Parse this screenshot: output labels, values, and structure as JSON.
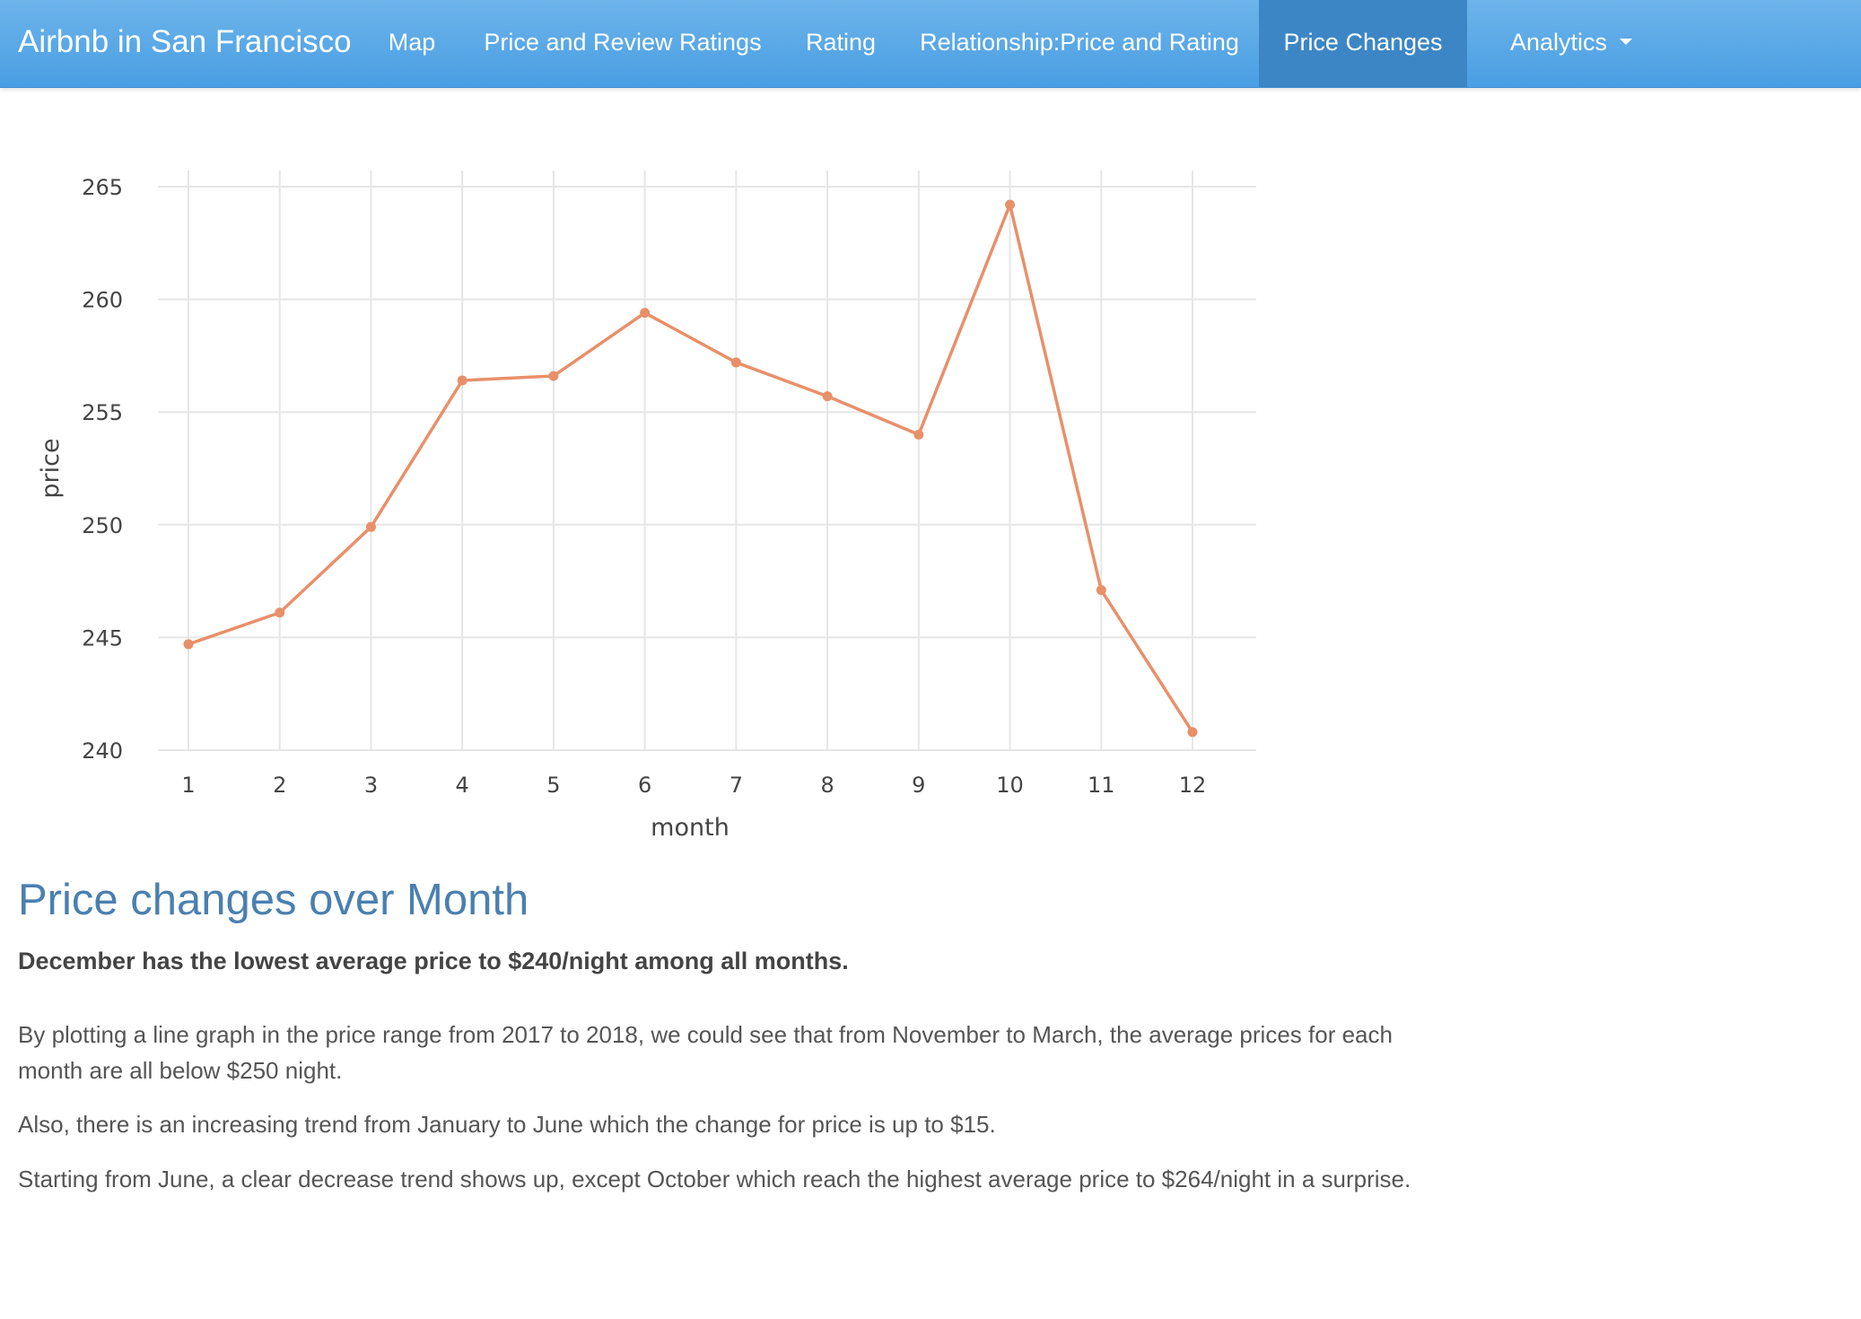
{
  "navbar": {
    "brand": "Airbnb in San Francisco",
    "items": [
      {
        "label": "Map"
      },
      {
        "label": "Price and Review Ratings"
      },
      {
        "label": "Rating"
      },
      {
        "label": "Relationship:Price and Rating"
      },
      {
        "label": "Price Changes",
        "active": true
      },
      {
        "label": "Analytics",
        "dropdown": true
      }
    ]
  },
  "chart_data": {
    "type": "line",
    "xlabel": "month",
    "ylabel": "price",
    "x": [
      1,
      2,
      3,
      4,
      5,
      6,
      7,
      8,
      9,
      10,
      11,
      12
    ],
    "values": [
      244.7,
      246.1,
      249.9,
      256.4,
      256.6,
      259.4,
      257.2,
      255.7,
      254.0,
      264.2,
      247.1,
      240.8
    ],
    "ylim": [
      240,
      265
    ],
    "yticks": [
      240,
      245,
      250,
      255,
      260,
      265
    ],
    "xticks": [
      1,
      2,
      3,
      4,
      5,
      6,
      7,
      8,
      9,
      10,
      11,
      12
    ],
    "grid": true,
    "line_color": "#e8906a"
  },
  "section": {
    "title": "Price changes over Month",
    "subtitle": "December has the lowest average price to $240/night among all months.",
    "paragraphs": [
      "By plotting a line graph in the price range from 2017 to 2018, we could see that from November to March, the average prices for each month are all below $250 night.",
      "Also, there is an increasing trend from January to June which the change for price is up to $15.",
      "Starting from June, a clear decrease trend shows up, except October which reach the highest average price to $264/night in a surprise."
    ]
  }
}
